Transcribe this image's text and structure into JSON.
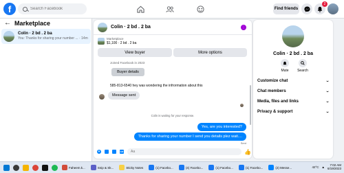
{
  "topbar": {
    "search_placeholder": "Search Facebook",
    "find_friends": "Find friends",
    "notification_count": "2"
  },
  "left": {
    "title": "Marketplace",
    "conversation": {
      "name": "Colin · 2 bd . 2 ba",
      "preview": "You: Thanks for sharing your number ...",
      "time": "14m"
    }
  },
  "chat": {
    "title": "Colin · 2 bd . 2 ba",
    "listing_label": "Marketplace",
    "listing_price": "$1,100 · 2 bd . 2 ba",
    "view_buyer": "View buyer",
    "more_options": "More options",
    "joined": "Joined Facebook in 2023",
    "buyer_details": "Buyer details",
    "message_1": "585-813-6540 hey was wondering the infrormation about this",
    "message_2": "Message sent",
    "waiting": "Colin is waiting for your response.",
    "reply_1": "Yes, are you interested?",
    "reply_2": "Thanks for sharing your number I send you details plez wait....",
    "sent_label": "Sent",
    "composer_placeholder": "Aa"
  },
  "right": {
    "title": "Colin · 2 bd . 2 ba",
    "mute": "Mute",
    "search": "Search",
    "menu": [
      "Customize chat",
      "Chat members",
      "Media, files and links",
      "Privacy & support"
    ]
  },
  "taskbar": {
    "apps": [
      "Faheem.k...",
      "Snip & Sk...",
      "Sticky Notes",
      "(1) Facebo...",
      "(4) Facebo...",
      "(1) Facebo...",
      "(1) Facebo...",
      "(2) Messe..."
    ],
    "app_colors": [
      "#d24c3a",
      "#5b5fc7",
      "#f7d046",
      "#1877f2",
      "#1877f2",
      "#1877f2",
      "#1877f2",
      "#0084ff"
    ],
    "temperature": "42°C",
    "time": "7:02 AM",
    "date": "6/19/2023"
  }
}
